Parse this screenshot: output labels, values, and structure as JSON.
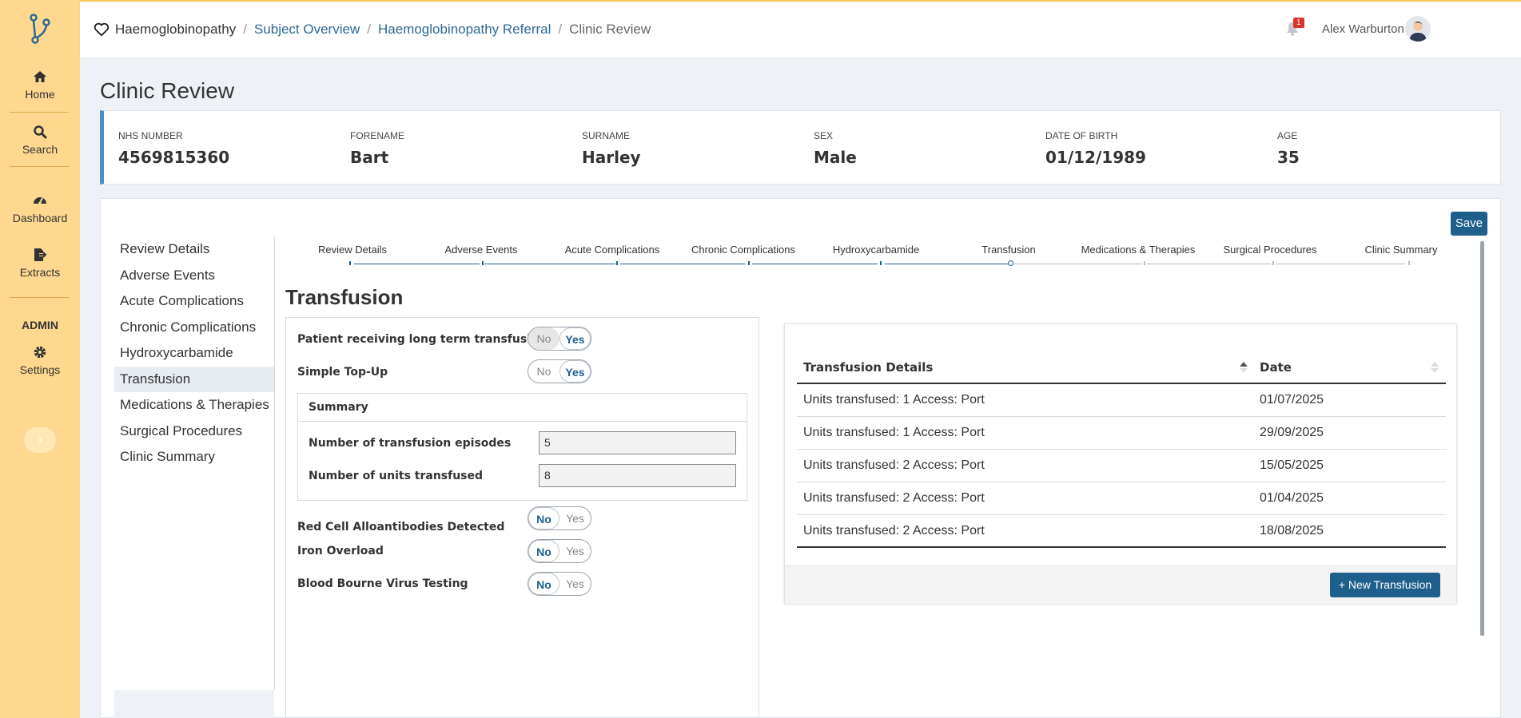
{
  "sidebar": {
    "items": [
      {
        "label": "Home",
        "icon": "home-icon"
      },
      {
        "label": "Search",
        "icon": "search-icon"
      },
      {
        "label": "Dashboard",
        "icon": "dashboard-icon"
      },
      {
        "label": "Extracts",
        "icon": "extracts-icon"
      }
    ],
    "admin_label": "ADMIN",
    "settings_label": "Settings",
    "collapse_glyph": "›"
  },
  "breadcrumb": {
    "root": "Haemoglobinopathy",
    "items": [
      "Subject Overview",
      "Haemoglobinopathy Referral"
    ],
    "current": "Clinic Review",
    "separator": "/"
  },
  "user": {
    "name": "Alex Warburton",
    "notification_count": "1"
  },
  "page_title": "Clinic Review",
  "patient": {
    "fields": [
      {
        "label": "NHS NUMBER",
        "value": "4569815360"
      },
      {
        "label": "FORENAME",
        "value": "Bart"
      },
      {
        "label": "SURNAME",
        "value": "Harley"
      },
      {
        "label": "SEX",
        "value": "Male"
      },
      {
        "label": "DATE OF BIRTH",
        "value": "01/12/1989"
      },
      {
        "label": "AGE",
        "value": "35"
      }
    ]
  },
  "save_label": "Save",
  "section_nav": {
    "items": [
      "Review Details",
      "Adverse Events",
      "Acute Complications",
      "Chronic Complications",
      "Hydroxycarbamide",
      "Transfusion",
      "Medications & Therapies",
      "Surgical Procedures",
      "Clinic Summary"
    ],
    "active": "Transfusion"
  },
  "stepper": {
    "steps": [
      "Review Details",
      "Adverse Events",
      "Acute Complications",
      "Chronic Complications",
      "Hydroxycarbamide",
      "Transfusion",
      "Medications & Therapies",
      "Surgical Procedures",
      "Clinic Summary"
    ],
    "current": "Transfusion"
  },
  "form": {
    "title": "Transfusion",
    "long_term": {
      "label": "Patient receiving long term transfusion",
      "no": "No",
      "yes": "Yes",
      "value": "Yes"
    },
    "simple_topup": {
      "label": "Simple Top-Up",
      "no": "No",
      "yes": "Yes",
      "value": "Yes"
    },
    "summary": {
      "heading": "Summary",
      "episodes_label": "Number of transfusion episodes",
      "episodes_value": "5",
      "units_label": "Number of units transfused",
      "units_value": "8"
    },
    "alloantibodies": {
      "label": "Red Cell Alloantibodies Detected",
      "no": "No",
      "yes": "Yes",
      "value": "No"
    },
    "iron_overload": {
      "label": "Iron Overload",
      "no": "No",
      "yes": "Yes",
      "value": "No"
    },
    "bbv_testing": {
      "label": "Blood Bourne Virus Testing",
      "no": "No",
      "yes": "Yes",
      "value": "No"
    }
  },
  "table": {
    "columns": [
      "Transfusion Details",
      "Date"
    ],
    "rows": [
      {
        "details": "Units transfused: 1 Access: Port",
        "date": "01/07/2025"
      },
      {
        "details": "Units transfused: 1 Access: Port",
        "date": "29/09/2025"
      },
      {
        "details": "Units transfused: 2 Access: Port",
        "date": "15/05/2025"
      },
      {
        "details": "Units transfused: 2 Access: Port",
        "date": "01/04/2025"
      },
      {
        "details": "Units transfused: 2 Access: Port",
        "date": "18/08/2025"
      }
    ],
    "new_button": "New Transfusion"
  },
  "colors": {
    "sidebar": "#ffd88f",
    "primary": "#1f5f8b",
    "link": "#2b6a94",
    "badge": "#d9362b"
  }
}
